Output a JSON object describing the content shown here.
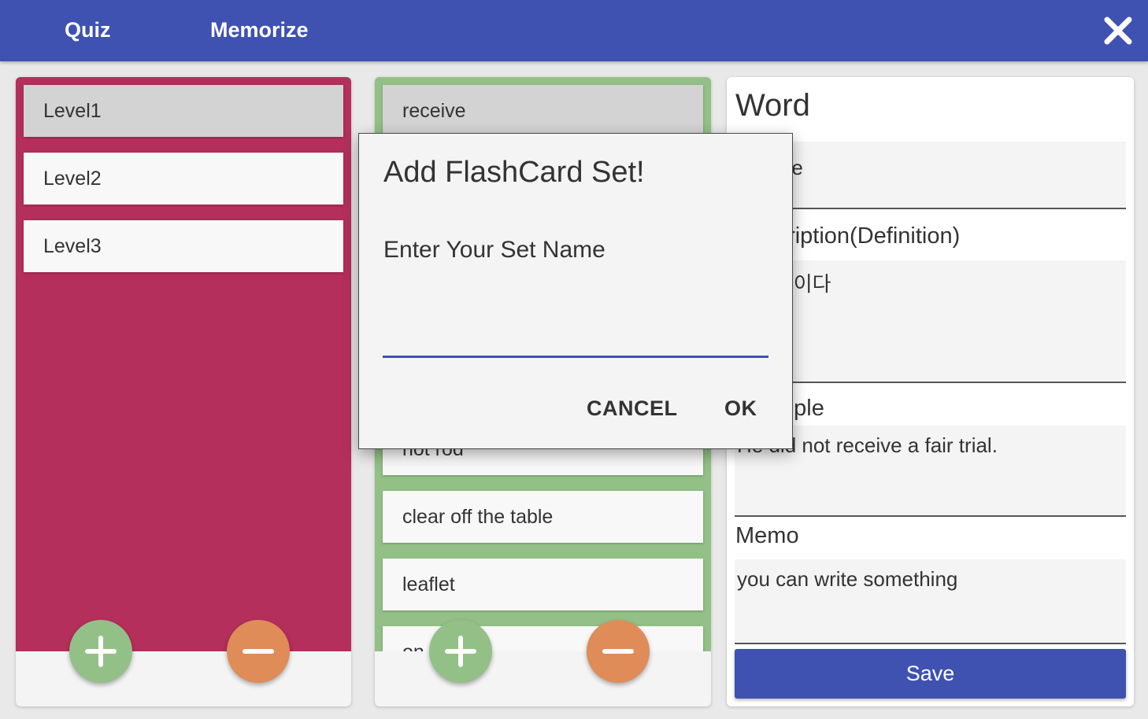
{
  "topbar": {
    "tabs": [
      "Quiz",
      "Memorize"
    ],
    "close_icon": "close-x-icon",
    "background": "#3f51b1"
  },
  "sets_panel": {
    "items": [
      "Level1",
      "Level2",
      "Level3"
    ],
    "selected_index": 0,
    "background": "#b42f5b",
    "add_icon": "plus-icon",
    "remove_icon": "minus-icon"
  },
  "cards_panel": {
    "items": [
      "receive",
      "not rod",
      "clear off the table",
      "leaflet",
      "on a tr"
    ],
    "selected_index": 0,
    "background": "#93c086",
    "add_icon": "plus-icon",
    "remove_icon": "minus-icon"
  },
  "editor": {
    "word_label": "Word",
    "word_value": "receive",
    "description_label": "Description(Definition)",
    "description_value": "받아들이다",
    "example_label": "Example",
    "example_value": "He did not receive a fair trial.",
    "memo_label": "Memo",
    "memo_value": "you can write something",
    "save_label": "Save"
  },
  "dialog": {
    "title": "Add FlashCard Set!",
    "prompt": "Enter Your Set Name",
    "input_value": "",
    "cancel_label": "CANCEL",
    "ok_label": "OK"
  },
  "colors": {
    "accent": "#3f51b1",
    "add": "#93c086",
    "remove": "#df8c59"
  }
}
